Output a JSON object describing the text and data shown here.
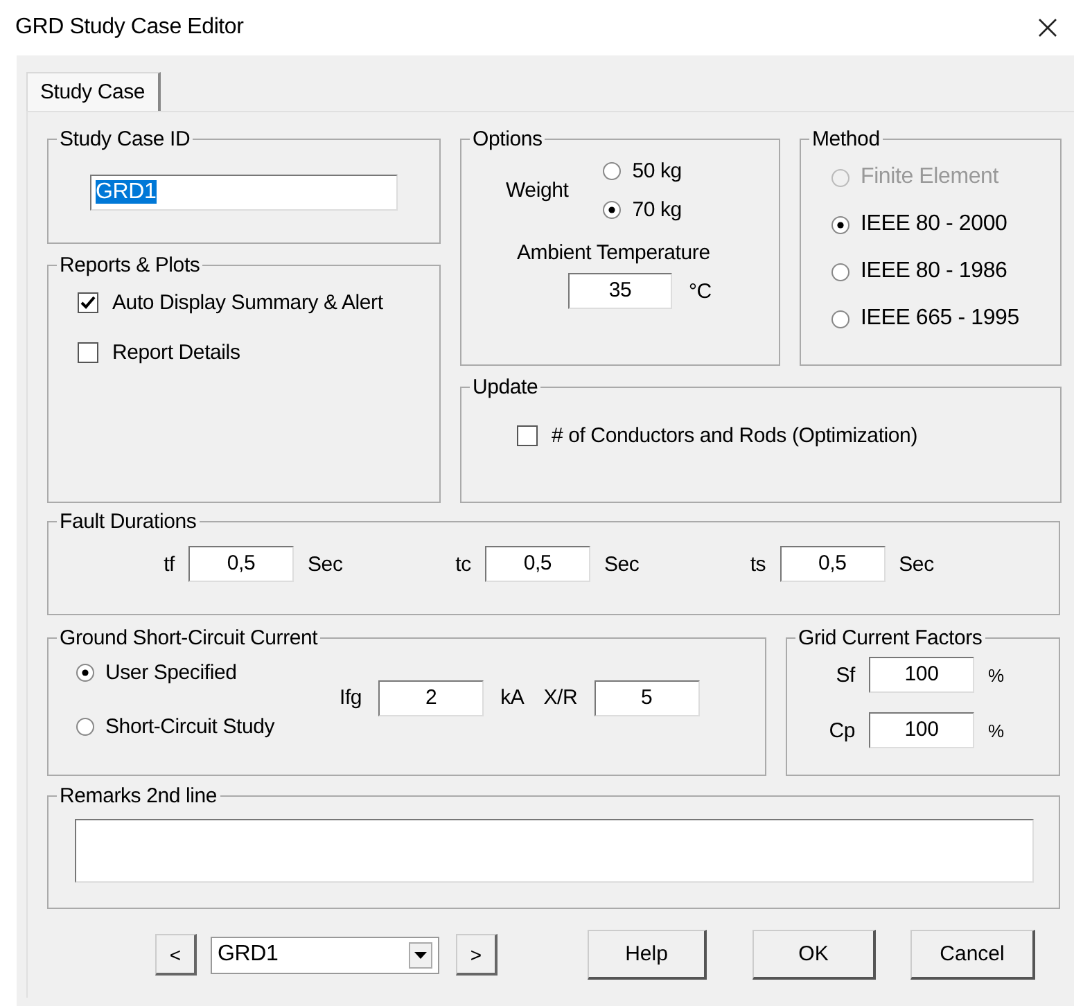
{
  "window": {
    "title": "GRD Study Case Editor"
  },
  "tabs": [
    {
      "label": "Study Case",
      "selected": true
    }
  ],
  "study_case_id": {
    "title": "Study Case ID",
    "value": "GRD1",
    "text_selected": true
  },
  "reports": {
    "title": "Reports & Plots",
    "items": [
      {
        "label": "Auto Display Summary & Alert",
        "checked": true
      },
      {
        "label": "Report Details",
        "checked": false
      }
    ]
  },
  "options": {
    "title": "Options",
    "weight_label": "Weight",
    "weights": [
      {
        "label": "50 kg",
        "selected": false
      },
      {
        "label": "70 kg",
        "selected": true
      }
    ],
    "temperature_label": "Ambient Temperature",
    "temperature": "35",
    "temperature_unit": "°C"
  },
  "method": {
    "title": "Method",
    "items": [
      {
        "label": "Finite Element",
        "selected": false,
        "disabled": true
      },
      {
        "label": "IEEE 80 - 2000",
        "selected": true,
        "disabled": false
      },
      {
        "label": "IEEE 80 - 1986",
        "selected": false,
        "disabled": false
      },
      {
        "label": "IEEE 665 - 1995",
        "selected": false,
        "disabled": false
      }
    ]
  },
  "update": {
    "title": "Update",
    "items": [
      {
        "label": "# of Conductors and Rods (Optimization)",
        "checked": false
      }
    ]
  },
  "fault_durations": {
    "title": "Fault Durations",
    "fields": [
      {
        "label": "tf",
        "value": "0,5",
        "unit": "Sec"
      },
      {
        "label": "tc",
        "value": "0,5",
        "unit": "Sec"
      },
      {
        "label": "ts",
        "value": "0,5",
        "unit": "Sec"
      }
    ]
  },
  "ground_current": {
    "title": "Ground Short-Circuit Current",
    "sources": [
      {
        "label": "User Specified",
        "selected": true
      },
      {
        "label": "Short-Circuit Study",
        "selected": false
      }
    ],
    "fields": [
      {
        "label": "Ifg",
        "value": "2",
        "unit": "kA"
      },
      {
        "label": "X/R",
        "value": "5"
      }
    ]
  },
  "grid_factors": {
    "title": "Grid Current Factors",
    "fields": [
      {
        "label": "Sf",
        "value": "100",
        "unit": "%"
      },
      {
        "label": "Cp",
        "value": "100",
        "unit": "%"
      }
    ]
  },
  "remarks": {
    "title": "Remarks 2nd line"
  },
  "footer": {
    "previous": "<",
    "case": "GRD1",
    "next": ">",
    "buttons": [
      "Help",
      "OK",
      "Cancel"
    ]
  }
}
